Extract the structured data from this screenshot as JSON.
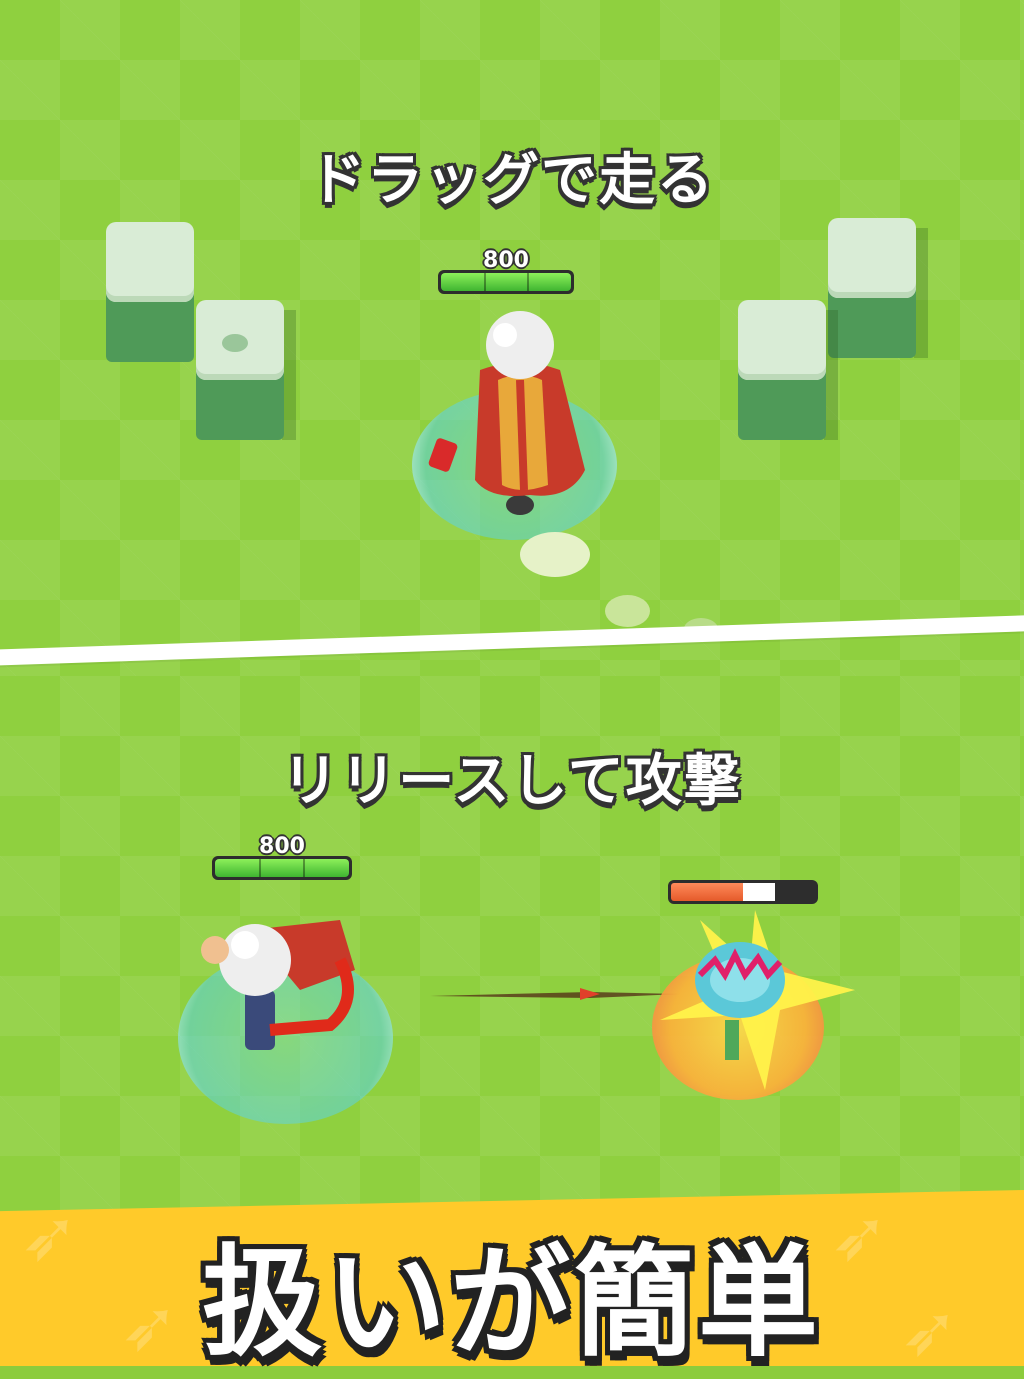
{
  "captions": {
    "top": "ドラッグで走る",
    "bottom": "リリースして攻撃"
  },
  "player_top": {
    "hp": "800"
  },
  "player_bottom": {
    "hp": "800"
  },
  "enemy": {
    "health_fraction": 0.5,
    "lost_fraction": 0.22
  },
  "banner": {
    "title": "扱いが簡単"
  },
  "colors": {
    "grass": "#8fd03f",
    "block_top": "#d9ecd6",
    "block_side": "#4f9a58",
    "hp_green": "#3fb531",
    "enemy_hp": "#e55a2a",
    "banner": "#ffca2a"
  },
  "icons": [
    "white-haired-archer-hero",
    "blue-shield-ring",
    "dust-cloud",
    "arrow",
    "plant-monster",
    "bow-icon"
  ]
}
